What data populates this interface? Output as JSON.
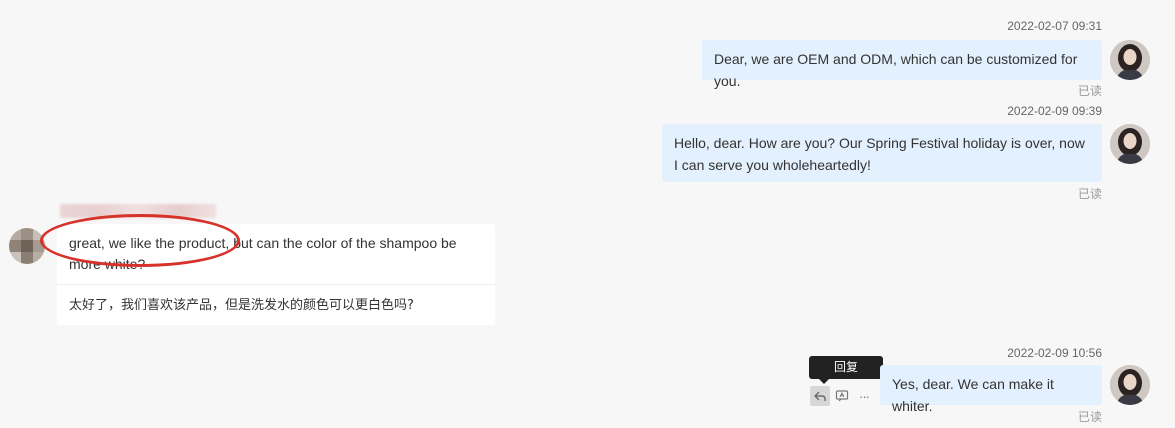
{
  "messages": [
    {
      "direction": "out",
      "timestamp": "2022-02-07 09:31",
      "text": "Dear, we are OEM and ODM, which can be customized for you.",
      "status": "已读"
    },
    {
      "direction": "out",
      "timestamp": "2022-02-09 09:39",
      "text": "Hello, dear. How are you? Our Spring Festival holiday is over, now I can serve you wholeheartedly!",
      "status": "已读"
    },
    {
      "direction": "in",
      "text": "great, we like the product, but can the color of the shampoo be more white?",
      "translation": "太好了，我们喜欢该产品，但是洗发水的颜色可以更白色吗?"
    },
    {
      "direction": "out",
      "timestamp": "2022-02-09 10:56",
      "text": "Yes, dear. We can make it whiter.",
      "status": "已读"
    }
  ],
  "actions": {
    "reply_tooltip": "回复",
    "reply_icon": "reply-icon",
    "translate_icon": "translate-icon",
    "more_icon": "more-icon",
    "more_glyph": "···"
  },
  "colors": {
    "outgoing_bubble": "#e3f0fd",
    "incoming_bubble": "#ffffff",
    "annotation": "#d7322a",
    "background": "#f7f7f7"
  }
}
